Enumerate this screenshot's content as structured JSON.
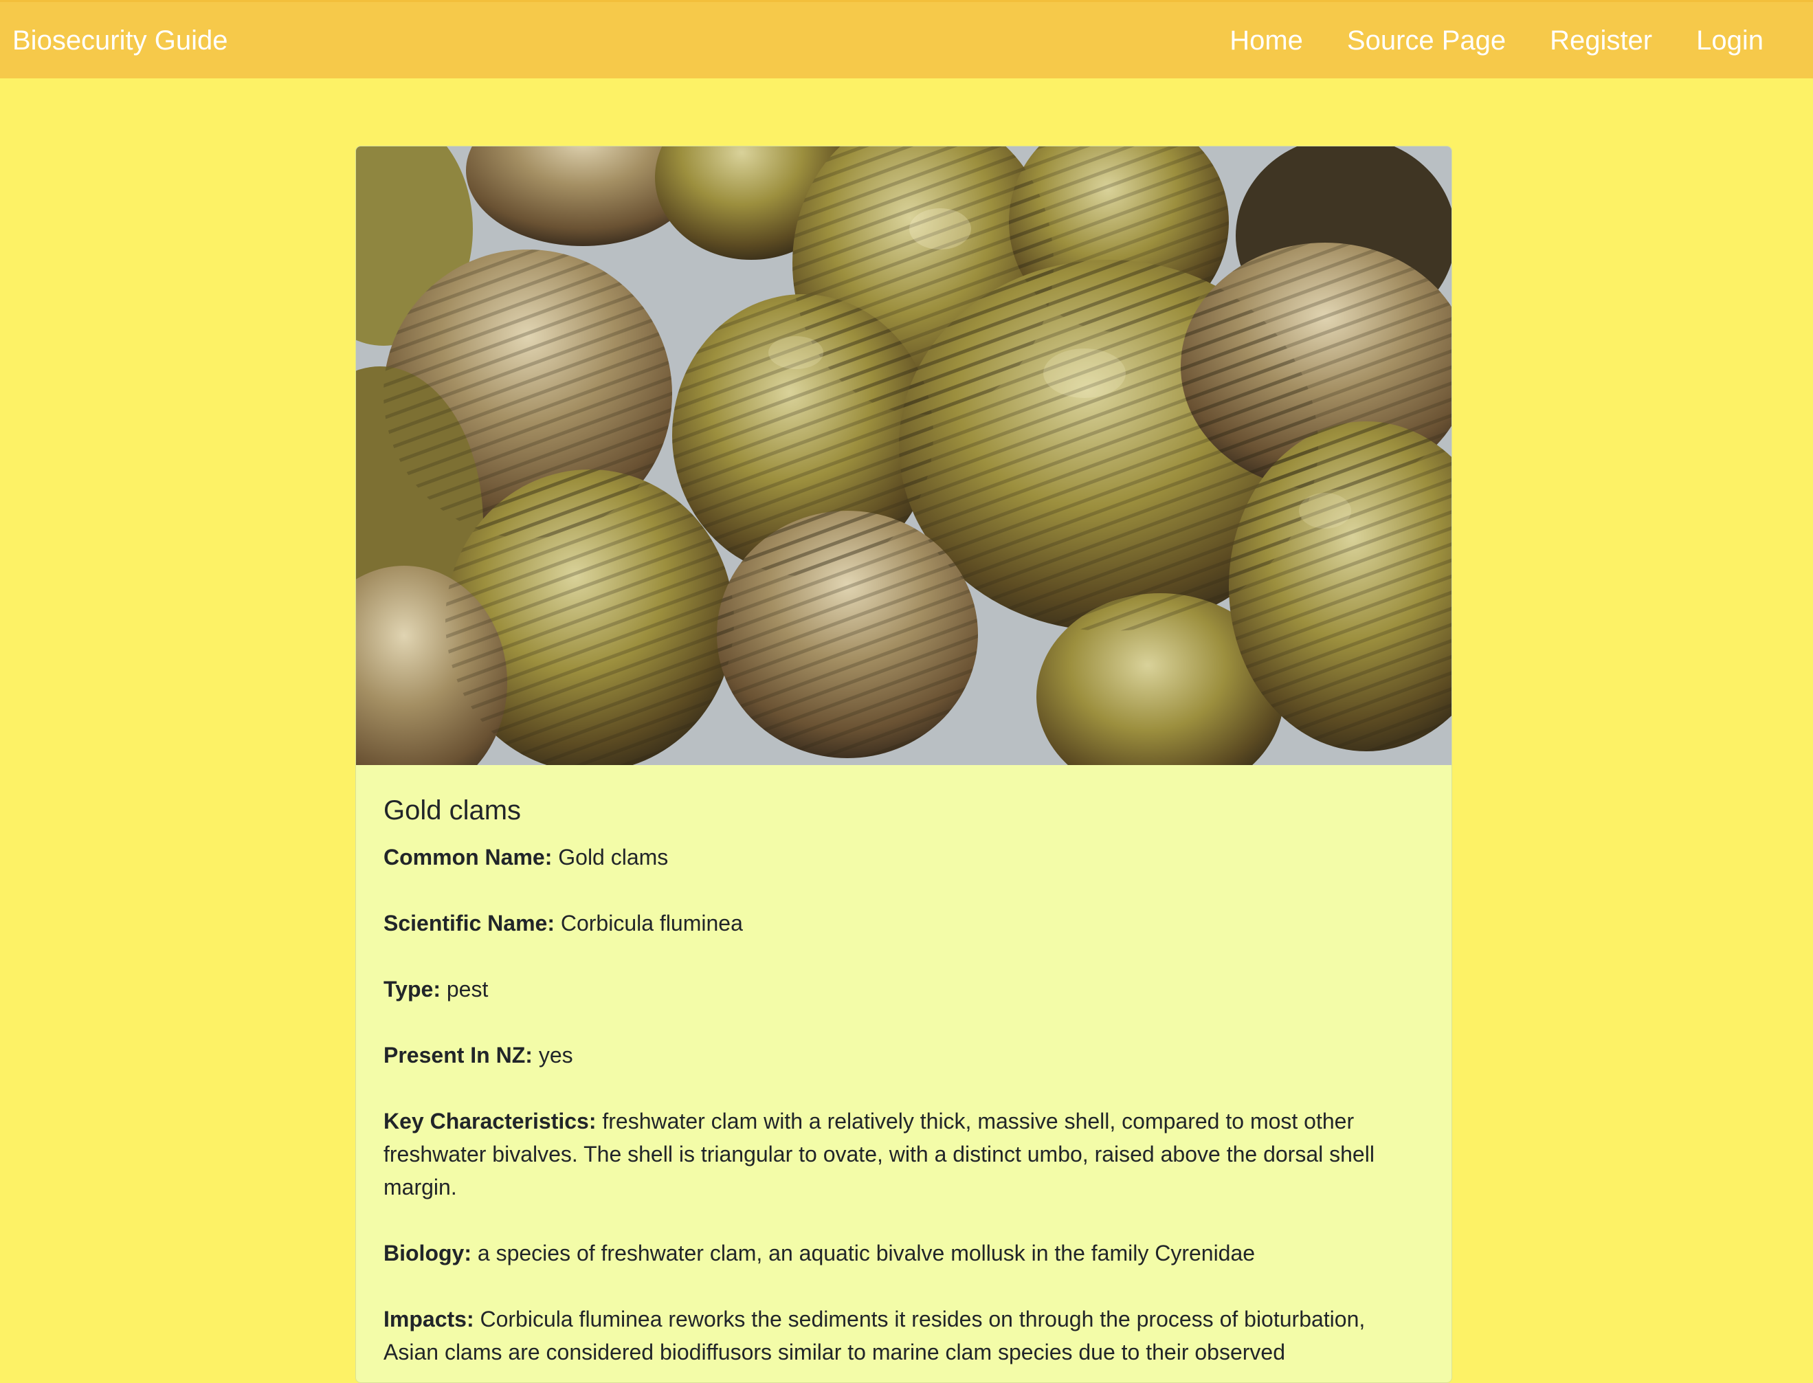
{
  "brand": {
    "title": "Biosecurity Guide"
  },
  "nav": {
    "items": [
      {
        "label": "Home"
      },
      {
        "label": "Source Page"
      },
      {
        "label": "Register"
      },
      {
        "label": "Login"
      }
    ]
  },
  "card": {
    "image_alt": "Gold clams",
    "title": "Gold clams",
    "fields": [
      {
        "label": "Common Name:",
        "value": "Gold clams"
      },
      {
        "label": "Scientific Name:",
        "value": "Corbicula fluminea"
      },
      {
        "label": "Type:",
        "value": "pest"
      },
      {
        "label": "Present In NZ:",
        "value": "yes"
      },
      {
        "label": "Key Characteristics:",
        "value": "freshwater clam with a relatively thick, massive shell, compared to most other freshwater bivalves. The shell is triangular to ovate, with a distinct umbo, raised above the dorsal shell margin."
      },
      {
        "label": "Biology:",
        "value": "a species of freshwater clam, an aquatic bivalve mollusk in the family Cyrenidae"
      },
      {
        "label": "Impacts:",
        "value": "Corbicula fluminea reworks the sediments it resides on through the process of bioturbation, Asian clams are considered biodiffusors similar to marine clam species due to their observed"
      }
    ]
  },
  "theme": {
    "page_bg": "#fdf266",
    "navbar_bg": "#f6c94a",
    "card_bg": "#f3fca8"
  }
}
